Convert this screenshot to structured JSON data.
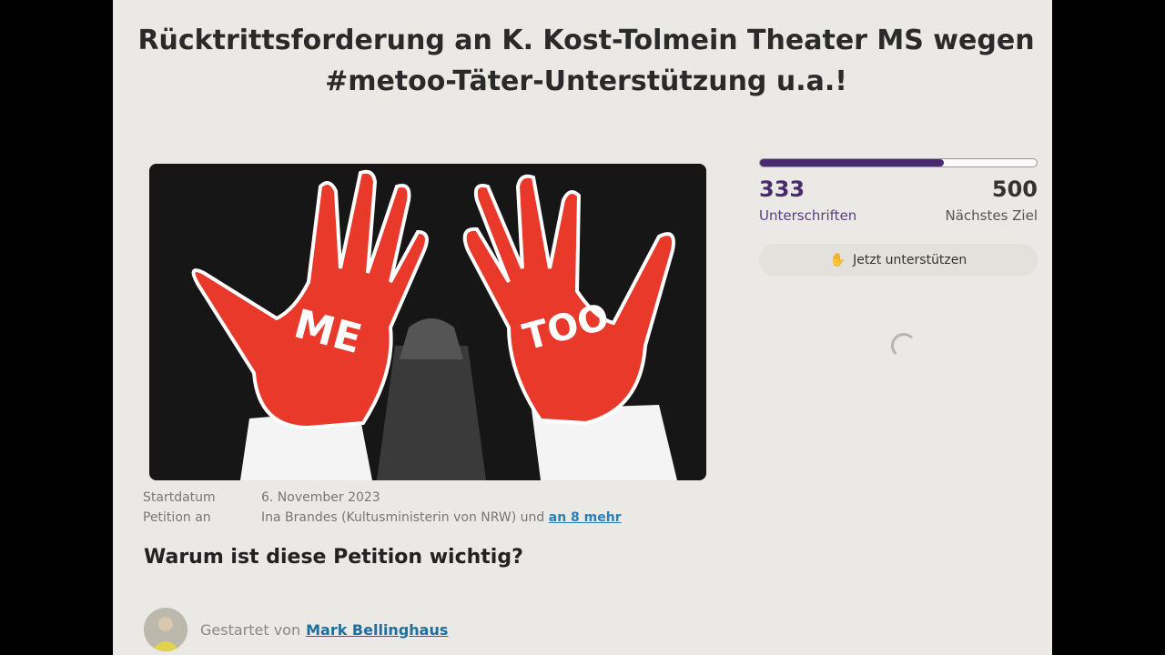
{
  "petition": {
    "title_line1": "Rücktrittsforderung an K. Kost-Tolmein Theater MS wegen",
    "title_line2": "#metoo-Täter-Unterstützung u.a.!",
    "image_text_left": "ME",
    "image_text_right": "TOO"
  },
  "meta": {
    "start_label": "Startdatum",
    "start_value": "6. November 2023",
    "target_label": "Petition an",
    "target_value": "Ina Brandes (Kultusministerin von NRW) und",
    "target_more": "an 8 mehr"
  },
  "section": {
    "heading": "Warum ist diese Petition wichtig?"
  },
  "author": {
    "prefix": "Gestartet von",
    "name": "Mark Bellinghaus"
  },
  "signatures": {
    "count": "333",
    "count_label": "Unterschriften",
    "goal": "500",
    "goal_label": "Nächstes Ziel",
    "progress_fraction": 0.666,
    "support_label": "Jetzt unterstützen",
    "support_icon": "hand-heart-icon"
  },
  "colors": {
    "accent": "#4a2a6e",
    "link": "#2a7fb8",
    "hand_red": "#e8392b"
  }
}
